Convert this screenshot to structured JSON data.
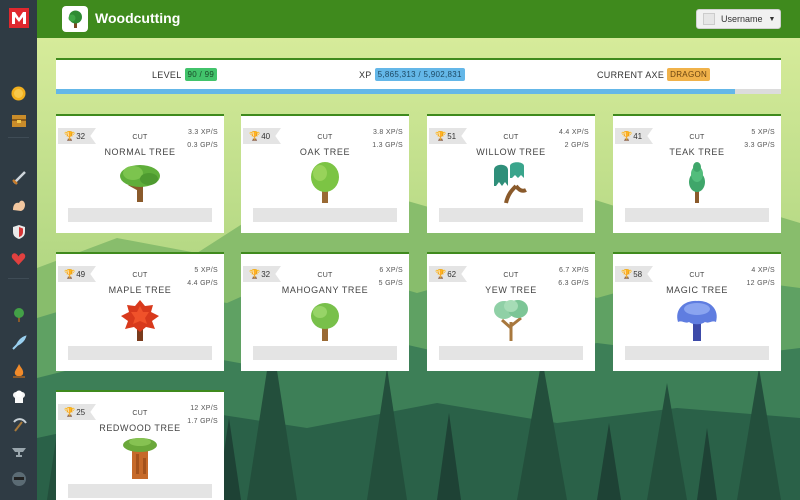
{
  "header": {
    "title": "Woodcutting",
    "username": "Username"
  },
  "stats": {
    "level_label": "LEVEL",
    "level_value": "90 / 99",
    "xp_label": "XP",
    "xp_value": "5,865,313 / 5,902,831",
    "axe_label": "CURRENT AXE",
    "axe_value": "DRAGON",
    "xp_progress": 0.937
  },
  "sidebar": {
    "logo": "m-logo-icon",
    "items": [
      "coin-icon",
      "bank-icon",
      "sword-icon",
      "strength-icon",
      "defence-shield-icon",
      "hitpoints-heart-icon",
      "woodcutting-tree-icon",
      "fishing-icon",
      "firemaking-icon",
      "cooking-icon",
      "mining-icon",
      "smithing-icon",
      "thieving-icon"
    ]
  },
  "trees": [
    {
      "mastery": "32",
      "cut": "CUT",
      "name": "NORMAL TREE",
      "xp": "3.3 XP/S",
      "gp": "0.3 GP/S",
      "icon": "normal-tree-icon"
    },
    {
      "mastery": "40",
      "cut": "CUT",
      "name": "OAK TREE",
      "xp": "3.8 XP/S",
      "gp": "1.3 GP/S",
      "icon": "oak-tree-icon"
    },
    {
      "mastery": "51",
      "cut": "CUT",
      "name": "WILLOW TREE",
      "xp": "4.4 XP/S",
      "gp": "2 GP/S",
      "icon": "willow-tree-icon"
    },
    {
      "mastery": "41",
      "cut": "CUT",
      "name": "TEAK TREE",
      "xp": "5 XP/S",
      "gp": "3.3 GP/S",
      "icon": "teak-tree-icon"
    },
    {
      "mastery": "49",
      "cut": "CUT",
      "name": "MAPLE TREE",
      "xp": "5 XP/S",
      "gp": "4.4 GP/S",
      "icon": "maple-tree-icon"
    },
    {
      "mastery": "32",
      "cut": "CUT",
      "name": "MAHOGANY TREE",
      "xp": "6 XP/S",
      "gp": "5 GP/S",
      "icon": "mahogany-tree-icon"
    },
    {
      "mastery": "62",
      "cut": "CUT",
      "name": "YEW TREE",
      "xp": "6.7 XP/S",
      "gp": "6.3 GP/S",
      "icon": "yew-tree-icon"
    },
    {
      "mastery": "58",
      "cut": "CUT",
      "name": "MAGIC TREE",
      "xp": "4 XP/S",
      "gp": "12 GP/S",
      "icon": "magic-tree-icon"
    },
    {
      "mastery": "25",
      "cut": "CUT",
      "name": "REDWOOD TREE",
      "xp": "12 XP/S",
      "gp": "1.7 GP/S",
      "icon": "redwood-tree-icon"
    }
  ],
  "colors": {
    "header_green": "#3f8a1d",
    "level_badge": "#42c36b",
    "xp_badge": "#64b7e8",
    "axe_badge": "#f0b24a",
    "sidebar": "#2f3b44"
  }
}
